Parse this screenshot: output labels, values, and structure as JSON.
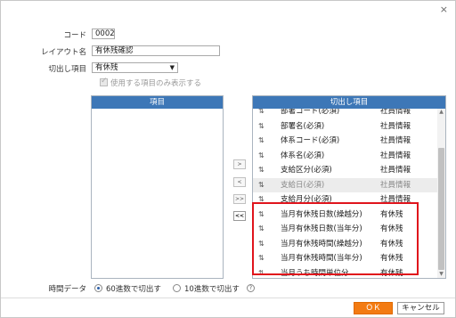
{
  "dialog": {
    "close_glyph": "×"
  },
  "form": {
    "code_label": "コード",
    "code_value": "0002",
    "layout_name_label": "レイアウト名",
    "layout_name_value": "有休残確認",
    "extract_label": "切出し項目",
    "extract_value": "有休残",
    "show_used_only_label": "使用する項目のみ表示する"
  },
  "left_panel": {
    "header": "項目"
  },
  "right_panel": {
    "header": "切出し項目",
    "rows": [
      {
        "name": "部署コード(必須)",
        "category": "社員情報",
        "disabled": false
      },
      {
        "name": "部署名(必須)",
        "category": "社員情報",
        "disabled": false
      },
      {
        "name": "体系コード(必須)",
        "category": "社員情報",
        "disabled": false
      },
      {
        "name": "体系名(必須)",
        "category": "社員情報",
        "disabled": false
      },
      {
        "name": "支給区分(必須)",
        "category": "社員情報",
        "disabled": false
      },
      {
        "name": "支給日(必須)",
        "category": "社員情報",
        "disabled": true
      },
      {
        "name": "支給月分(必須)",
        "category": "社員情報",
        "disabled": false
      },
      {
        "name": "当月有休残日数(繰越分)",
        "category": "有休残",
        "disabled": false
      },
      {
        "name": "当月有休残日数(当年分)",
        "category": "有休残",
        "disabled": false
      },
      {
        "name": "当月有休残時間(繰越分)",
        "category": "有休残",
        "disabled": false
      },
      {
        "name": "当月有休残時間(当年分)",
        "category": "有休残",
        "disabled": false
      },
      {
        "name": "当月うち時間単位分",
        "category": "有休残",
        "disabled": false
      }
    ]
  },
  "move_buttons": [
    ">",
    "<",
    ">>",
    "<<"
  ],
  "time_data": {
    "label": "時間データ",
    "option_60": "60進数で切出す",
    "option_10": "10進数で切出す",
    "selected": "60"
  },
  "footer": {
    "ok_label": "ＯＫ",
    "cancel_label": "キャンセル"
  },
  "colors": {
    "panel_header": "#3d77b7",
    "ok_button": "#f37b12",
    "highlight_box": "#e0141c"
  },
  "icons": {
    "sort": "sort-arrows-icon",
    "help": "help-circle-icon",
    "close": "close-icon"
  }
}
